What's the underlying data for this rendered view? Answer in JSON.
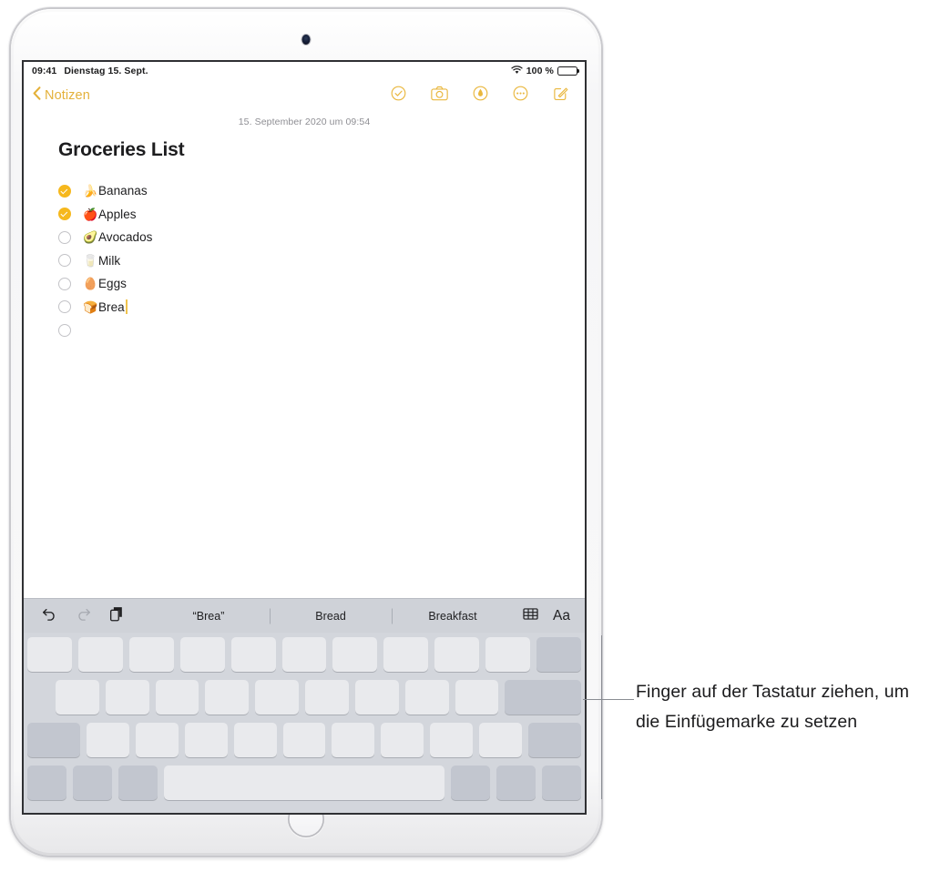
{
  "device": {
    "camera_icon": "front-camera-dot",
    "home_button_label": "home-button"
  },
  "status_bar": {
    "time": "09:41",
    "date": "Dienstag 15. Sept.",
    "wifi_icon": "wifi-icon",
    "battery_percent": "100 %",
    "battery_icon": "battery-full-icon"
  },
  "nav_bar": {
    "back_chevron_icon": "chevron-left-icon",
    "back_label": "Notizen",
    "icons": [
      {
        "name": "checklist-circle-icon",
        "label": "Checkliste"
      },
      {
        "name": "camera-icon",
        "label": "Kamera"
      },
      {
        "name": "markup-pen-circle-icon",
        "label": "Markierung"
      },
      {
        "name": "more-ellipsis-circle-icon",
        "label": "Mehr"
      },
      {
        "name": "compose-icon",
        "label": "Neue Notiz"
      }
    ]
  },
  "note": {
    "date": "15. September 2020 um 09:54",
    "title": "Groceries List",
    "items": [
      {
        "checked": true,
        "emoji": "🍌",
        "emoji_name": "banana-emoji",
        "text": "Bananas",
        "caret": false
      },
      {
        "checked": true,
        "emoji": "🍎",
        "emoji_name": "apple-emoji",
        "text": "Apples",
        "caret": false
      },
      {
        "checked": false,
        "emoji": "🥑",
        "emoji_name": "avocado-emoji",
        "text": "Avocados",
        "caret": false
      },
      {
        "checked": false,
        "emoji": "🥛",
        "emoji_name": "milk-emoji",
        "text": "Milk",
        "caret": false
      },
      {
        "checked": false,
        "emoji": "🥚",
        "emoji_name": "egg-emoji",
        "text": "Eggs",
        "caret": false
      },
      {
        "checked": false,
        "emoji": "🍞",
        "emoji_name": "bread-emoji",
        "text": "Brea",
        "caret": true
      },
      {
        "checked": false,
        "emoji": "",
        "emoji_name": "none",
        "text": "",
        "caret": false
      }
    ]
  },
  "shortcut_bar": {
    "undo_icon": "undo-arrow-icon",
    "redo_icon": "redo-arrow-icon",
    "paste_icon": "paste-clipboard-icon",
    "predictions": [
      "“Brea”",
      "Bread",
      "Breakfast"
    ],
    "table_icon": "table-grid-icon",
    "format_label": "Aa"
  },
  "keyboard": {
    "rows": [
      {
        "keys": [
          {
            "w": "",
            "dark": false
          },
          {
            "w": "",
            "dark": false
          },
          {
            "w": "",
            "dark": false
          },
          {
            "w": "",
            "dark": false
          },
          {
            "w": "",
            "dark": false
          },
          {
            "w": "",
            "dark": false
          },
          {
            "w": "",
            "dark": false
          },
          {
            "w": "",
            "dark": false
          },
          {
            "w": "",
            "dark": false
          },
          {
            "w": "",
            "dark": false
          },
          {
            "w": "",
            "dark": true
          }
        ]
      },
      {
        "lead_half": true,
        "keys": [
          {
            "w": "",
            "dark": false
          },
          {
            "w": "",
            "dark": false
          },
          {
            "w": "",
            "dark": false
          },
          {
            "w": "",
            "dark": false
          },
          {
            "w": "",
            "dark": false
          },
          {
            "w": "",
            "dark": false
          },
          {
            "w": "",
            "dark": false
          },
          {
            "w": "",
            "dark": false
          },
          {
            "w": "",
            "dark": false
          },
          {
            "w": "w-175",
            "dark": true
          }
        ]
      },
      {
        "keys": [
          {
            "w": "w-125",
            "dark": true
          },
          {
            "w": "",
            "dark": false
          },
          {
            "w": "",
            "dark": false
          },
          {
            "w": "",
            "dark": false
          },
          {
            "w": "",
            "dark": false
          },
          {
            "w": "",
            "dark": false
          },
          {
            "w": "",
            "dark": false
          },
          {
            "w": "",
            "dark": false
          },
          {
            "w": "",
            "dark": false
          },
          {
            "w": "",
            "dark": false
          },
          {
            "w": "w-125",
            "dark": true
          }
        ]
      },
      {
        "keys": [
          {
            "w": "",
            "dark": true
          },
          {
            "w": "",
            "dark": true
          },
          {
            "w": "",
            "dark": true
          },
          {
            "w": "w-space",
            "dark": false
          },
          {
            "w": "",
            "dark": true
          },
          {
            "w": "",
            "dark": true
          },
          {
            "w": "",
            "dark": true
          }
        ]
      }
    ]
  },
  "callout": {
    "text": "Finger auf der Tastatur ziehen, um die Einfügemarke zu setzen"
  }
}
